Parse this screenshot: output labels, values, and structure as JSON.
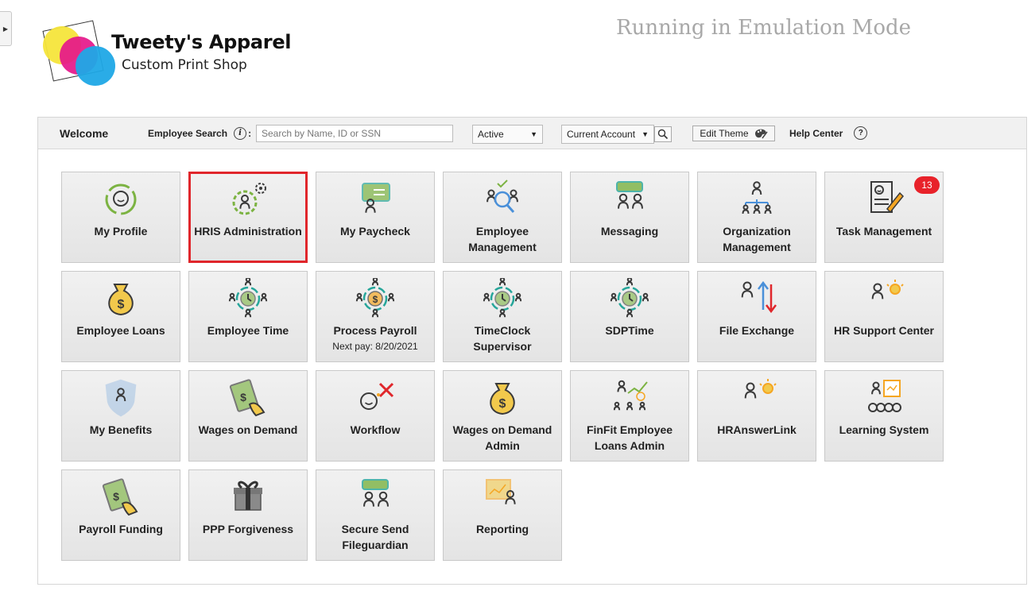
{
  "brand": {
    "title": "Tweety's Apparel",
    "subtitle": "Custom Print Shop"
  },
  "emulation_text": "Running in Emulation Mode",
  "toolbar": {
    "welcome": "Welcome",
    "employee_search_label": "Employee Search",
    "search_placeholder": "Search by Name, ID or SSN",
    "status_select": "Active",
    "account_select": "Current Account",
    "edit_theme": "Edit Theme",
    "help_center": "Help Center"
  },
  "tiles": [
    {
      "label": "My Profile",
      "icon": "profile-icon",
      "sub": ""
    },
    {
      "label": "HRIS Administration",
      "icon": "settings-person-icon",
      "sub": ""
    },
    {
      "label": "My Paycheck",
      "icon": "paycheck-icon",
      "sub": ""
    },
    {
      "label": "Employee Management",
      "icon": "employee-search-icon",
      "sub": ""
    },
    {
      "label": "Messaging",
      "icon": "messaging-icon",
      "sub": ""
    },
    {
      "label": "Organization Management",
      "icon": "org-chart-icon",
      "sub": ""
    },
    {
      "label": "Task Management",
      "icon": "task-icon",
      "sub": "",
      "badge": "13"
    },
    {
      "label": "Employee Loans",
      "icon": "money-bag-icon",
      "sub": ""
    },
    {
      "label": "Employee Time",
      "icon": "clock-people-icon",
      "sub": ""
    },
    {
      "label": "Process Payroll",
      "icon": "payroll-cycle-icon",
      "sub": "Next pay: 8/20/2021"
    },
    {
      "label": "TimeClock Supervisor",
      "icon": "clock-people-icon",
      "sub": ""
    },
    {
      "label": "SDPTime",
      "icon": "clock-people-icon",
      "sub": ""
    },
    {
      "label": "File Exchange",
      "icon": "file-exchange-icon",
      "sub": ""
    },
    {
      "label": "HR Support Center",
      "icon": "idea-person-icon",
      "sub": ""
    },
    {
      "label": "My Benefits",
      "icon": "shield-person-icon",
      "sub": ""
    },
    {
      "label": "Wages on Demand",
      "icon": "cash-hand-icon",
      "sub": ""
    },
    {
      "label": "Workflow",
      "icon": "workflow-icon",
      "sub": ""
    },
    {
      "label": "Wages on Demand Admin",
      "icon": "money-bag-icon",
      "sub": ""
    },
    {
      "label": "FinFit Employee Loans Admin",
      "icon": "growth-people-icon",
      "sub": ""
    },
    {
      "label": "HRAnswerLink",
      "icon": "idea-person-icon",
      "sub": ""
    },
    {
      "label": "Learning System",
      "icon": "presentation-icon",
      "sub": ""
    },
    {
      "label": "Payroll Funding",
      "icon": "cash-hand-icon",
      "sub": ""
    },
    {
      "label": "PPP Forgiveness",
      "icon": "gift-icon",
      "sub": ""
    },
    {
      "label": "Secure Send Fileguardian",
      "icon": "messaging-icon",
      "sub": ""
    },
    {
      "label": "Reporting",
      "icon": "report-person-icon",
      "sub": ""
    }
  ],
  "selected_tile": "HRIS Administration",
  "colors": {
    "green": "#7cb342",
    "teal": "#26a69a",
    "orange": "#f5a623",
    "gold": "#f2c94c",
    "blue": "#4a90d9",
    "red": "#e0262b",
    "dark": "#3a3a3a"
  }
}
